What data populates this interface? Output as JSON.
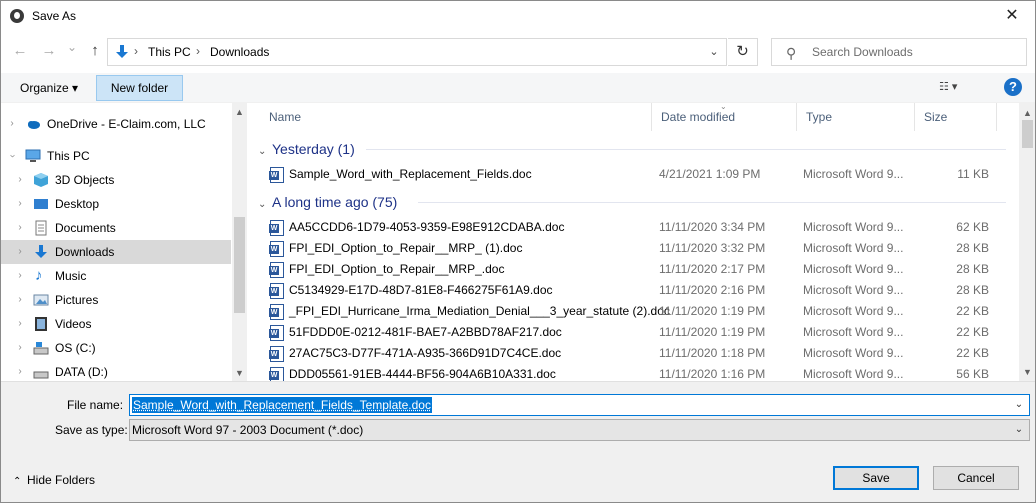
{
  "window": {
    "title": "Save As",
    "close_symbol": "✕"
  },
  "navigation": {
    "back_symbol": "←",
    "forward_symbol": "→",
    "recent_symbol": "⌄",
    "up_symbol": "↑",
    "breadcrumb": [
      "This PC",
      "Downloads"
    ],
    "refresh_symbol": "↻"
  },
  "search": {
    "placeholder": "Search Downloads"
  },
  "toolbar": {
    "organize_label": "Organize ▾",
    "new_folder_label": "New folder",
    "view_symbol": "☷ ▾",
    "help_symbol": "?"
  },
  "sidebar": {
    "items": [
      {
        "label": "OneDrive - E-Claim.com, LLC",
        "icon": "cloud-icon",
        "selected": false
      },
      {
        "label": "This PC",
        "icon": "computer-icon",
        "selected": false
      },
      {
        "label": "3D Objects",
        "icon": "cube-icon",
        "selected": false
      },
      {
        "label": "Desktop",
        "icon": "desktop-icon",
        "selected": false
      },
      {
        "label": "Documents",
        "icon": "documents-icon",
        "selected": false
      },
      {
        "label": "Downloads",
        "icon": "download-icon",
        "selected": true
      },
      {
        "label": "Music",
        "icon": "music-icon",
        "selected": false
      },
      {
        "label": "Pictures",
        "icon": "pictures-icon",
        "selected": false
      },
      {
        "label": "Videos",
        "icon": "videos-icon",
        "selected": false
      },
      {
        "label": "OS (C:)",
        "icon": "drive-icon",
        "selected": false
      },
      {
        "label": "DATA (D:)",
        "icon": "drive-icon",
        "selected": false
      }
    ]
  },
  "file_list": {
    "columns": [
      "Name",
      "Date modified",
      "Type",
      "Size"
    ],
    "groups": [
      {
        "label": "Yesterday (1)",
        "files": [
          {
            "name": "Sample_Word_with_Replacement_Fields.doc",
            "date": "4/21/2021 1:09 PM",
            "type": "Microsoft Word 9...",
            "size": "11 KB"
          }
        ]
      },
      {
        "label": "A long time ago (75)",
        "files": [
          {
            "name": "AA5CCDD6-1D79-4053-9359-E98E912CDABA.doc",
            "date": "11/11/2020 3:34 PM",
            "type": "Microsoft Word 9...",
            "size": "62 KB"
          },
          {
            "name": "FPI_EDI_Option_to_Repair__MRP_ (1).doc",
            "date": "11/11/2020 3:32 PM",
            "type": "Microsoft Word 9...",
            "size": "28 KB"
          },
          {
            "name": "FPI_EDI_Option_to_Repair__MRP_.doc",
            "date": "11/11/2020 2:17 PM",
            "type": "Microsoft Word 9...",
            "size": "28 KB"
          },
          {
            "name": "C5134929-E17D-48D7-81E8-F466275F61A9.doc",
            "date": "11/11/2020 2:16 PM",
            "type": "Microsoft Word 9...",
            "size": "28 KB"
          },
          {
            "name": "_FPI_EDI_Hurricane_Irma_Mediation_Denial___3_year_statute (2).doc",
            "date": "11/11/2020 1:19 PM",
            "type": "Microsoft Word 9...",
            "size": "22 KB"
          },
          {
            "name": "51FDDD0E-0212-481F-BAE7-A2BBD78AF217.doc",
            "date": "11/11/2020 1:19 PM",
            "type": "Microsoft Word 9...",
            "size": "22 KB"
          },
          {
            "name": "27AC75C3-D77F-471A-A935-366D91D7C4CE.doc",
            "date": "11/11/2020 1:18 PM",
            "type": "Microsoft Word 9...",
            "size": "22 KB"
          },
          {
            "name": "DDD05561-91EB-4444-BF56-904A6B10A331.doc",
            "date": "11/11/2020 1:16 PM",
            "type": "Microsoft Word 9...",
            "size": "56 KB"
          }
        ]
      }
    ]
  },
  "save_form": {
    "file_name_label": "File name:",
    "file_name_value": "Sample_Word_with_Replacement_Fields_Template.doc",
    "save_type_label": "Save as type:",
    "save_type_value": "Microsoft Word 97 - 2003 Document (*.doc)",
    "hide_folders_label": "Hide Folders",
    "save_label": "Save",
    "cancel_label": "Cancel"
  },
  "colors": {
    "accent": "#0078d7",
    "group_header": "#1e3287",
    "selection": "#cce4f7"
  }
}
